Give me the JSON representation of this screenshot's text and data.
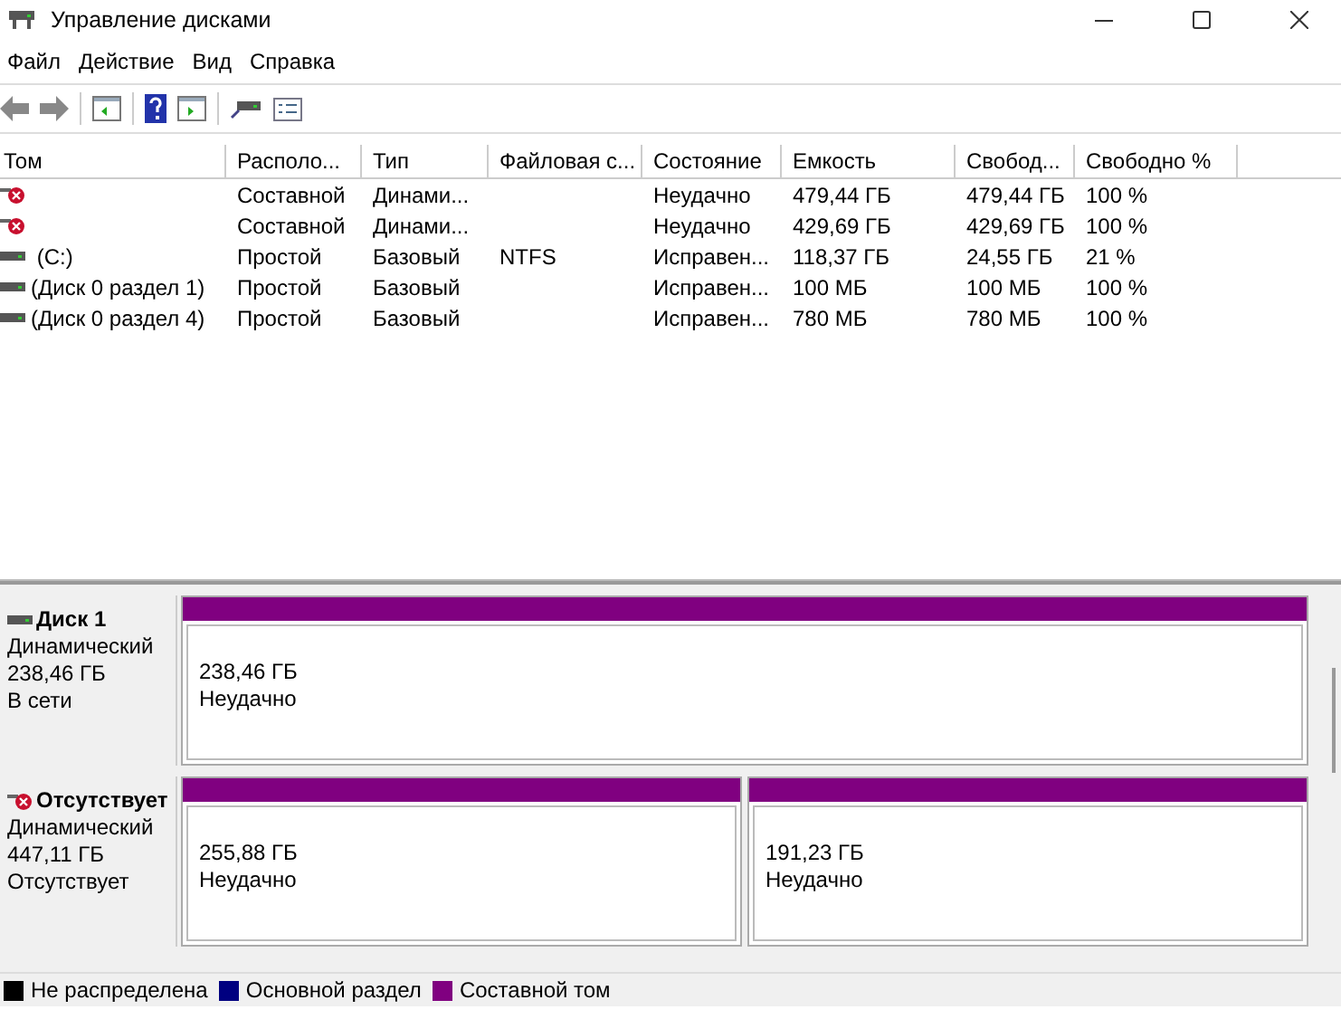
{
  "window": {
    "title": "Управление дисками"
  },
  "menu": [
    "Файл",
    "Действие",
    "Вид",
    "Справка"
  ],
  "table": {
    "columns": [
      "Том",
      "Располо...",
      "Тип",
      "Файловая с...",
      "Состояние",
      "Емкость",
      "Свобод...",
      "Свободно %"
    ],
    "rows": [
      {
        "kind": "failed",
        "cells": [
          "",
          "Составной",
          "Динами...",
          "",
          "Неудачно",
          "479,44 ГБ",
          "479,44 ГБ",
          "100 %"
        ]
      },
      {
        "kind": "failed",
        "cells": [
          "",
          "Составной",
          "Динами...",
          "",
          "Неудачно",
          "429,69 ГБ",
          "429,69 ГБ",
          "100 %"
        ]
      },
      {
        "kind": "healthy",
        "cells": [
          " (C:)",
          "Простой",
          "Базовый",
          "NTFS",
          "Исправен...",
          "118,37 ГБ",
          "24,55 ГБ",
          "21 %"
        ]
      },
      {
        "kind": "healthy",
        "cells": [
          "(Диск 0 раздел 1)",
          "Простой",
          "Базовый",
          "",
          "Исправен...",
          "100 МБ",
          "100 МБ",
          "100 %"
        ]
      },
      {
        "kind": "healthy",
        "cells": [
          "(Диск 0 раздел 4)",
          "Простой",
          "Базовый",
          "",
          "Исправен...",
          "780 МБ",
          "780 МБ",
          "100 %"
        ]
      }
    ]
  },
  "disks": [
    {
      "kind": "online",
      "name": "Диск 1",
      "type": "Динамический",
      "size": "238,46 ГБ",
      "status": "В сети",
      "partitions": [
        {
          "size": "238,46 ГБ",
          "status": "Неудачно",
          "color": "#800080"
        }
      ]
    },
    {
      "kind": "missing",
      "name": "Отсутствует",
      "type": "Динамический",
      "size": "447,11 ГБ",
      "status": "Отсутствует",
      "partitions": [
        {
          "size": "255,88 ГБ",
          "status": "Неудачно",
          "color": "#800080"
        },
        {
          "size": "191,23 ГБ",
          "status": "Неудачно",
          "color": "#800080"
        }
      ]
    }
  ],
  "legend": [
    {
      "label": "Не распределена",
      "color": "#000000"
    },
    {
      "label": "Основной раздел",
      "color": "#000080"
    },
    {
      "label": "Составной том",
      "color": "#800080"
    }
  ]
}
